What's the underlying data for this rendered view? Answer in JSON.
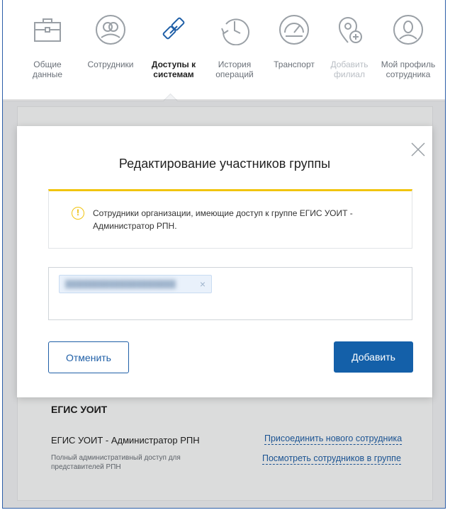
{
  "nav": {
    "items": [
      {
        "label": "Общие\nданные",
        "icon": "briefcase-icon",
        "state": "normal"
      },
      {
        "label": "Сотрудники",
        "icon": "users-icon",
        "state": "normal"
      },
      {
        "label": "Доступы к\nсистемам",
        "icon": "link-icon",
        "state": "active"
      },
      {
        "label": "История\nопераций",
        "icon": "history-icon",
        "state": "normal"
      },
      {
        "label": "Транспорт",
        "icon": "speedometer-icon",
        "state": "normal"
      },
      {
        "label": "Добавить\nфилиал",
        "icon": "add-location-icon",
        "state": "disabled"
      },
      {
        "label": "Мой профиль\nсотрудника",
        "icon": "profile-icon",
        "state": "normal"
      }
    ]
  },
  "background": {
    "section_title": "ЕГИС УОИТ",
    "group_name": "ЕГИС УОИТ - Администратор РПН",
    "group_description": "Полный административный доступ для представителей РПН",
    "link_join": "Присоединить нового сотрудника",
    "link_view": "Посмотреть сотрудников в группе"
  },
  "modal": {
    "title": "Редактирование участников группы",
    "alert_icon": "!",
    "alert_text": "Сотрудники организации, имеющие доступ к группе ЕГИС УОИТ - Администратор РПН.",
    "member_chip_remove": "×",
    "cancel_label": "Отменить",
    "add_label": "Добавить"
  },
  "colors": {
    "primary": "#1460a9",
    "link": "#1f5fa7",
    "alert_accent": "#f1c40f",
    "chip_bg": "#e9f1fb"
  }
}
